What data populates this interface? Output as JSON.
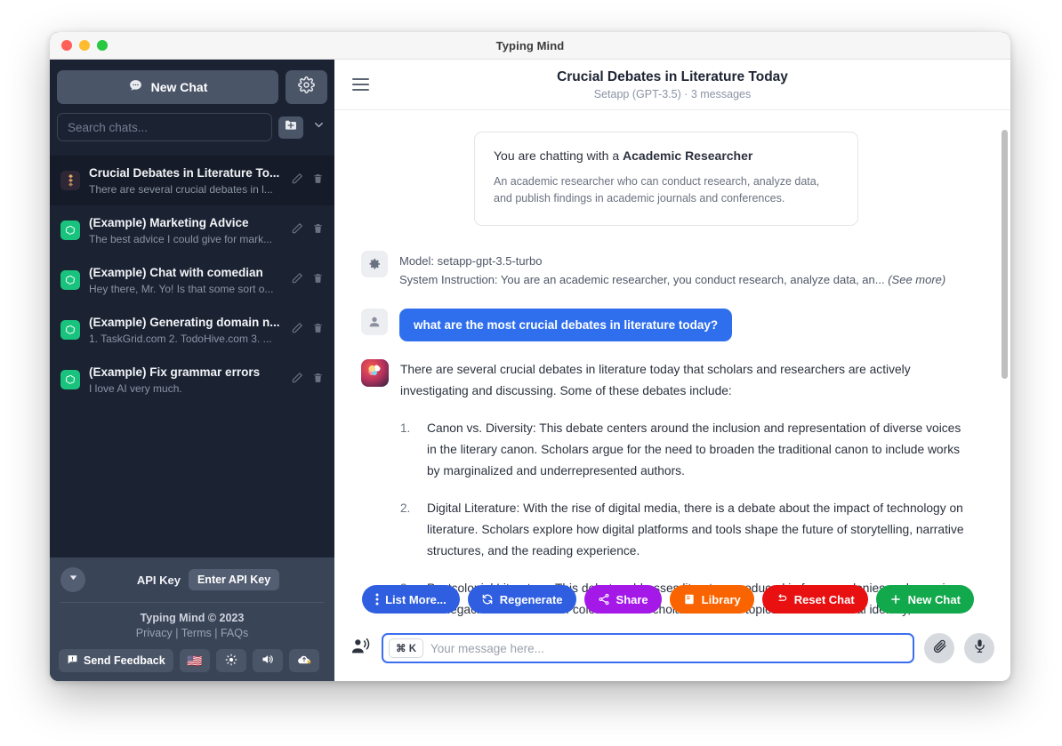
{
  "window": {
    "title": "Typing Mind",
    "traffic_lights": [
      "close-red",
      "minimize-yellow",
      "maximize-green"
    ]
  },
  "sidebar": {
    "new_chat_label": "New Chat",
    "settings_icon": "gear-icon",
    "search_placeholder": "Search chats...",
    "search_value": "",
    "new_folder_icon": "folder-plus-icon",
    "chevron_icon": "chevron-down-icon",
    "chats": [
      {
        "title": "Crucial Debates in Literature To...",
        "preview": "There are several crucial debates in l...",
        "avatar": "setapp-icon",
        "active": true
      },
      {
        "title": "(Example) Marketing Advice",
        "preview": "The best advice I could give for mark...",
        "avatar": "openai-icon",
        "active": false
      },
      {
        "title": "(Example) Chat with comedian",
        "preview": "Hey there, Mr. Yo! Is that some sort o...",
        "avatar": "openai-icon",
        "active": false
      },
      {
        "title": "(Example) Generating domain n...",
        "preview": "1. TaskGrid.com 2. TodoHive.com 3. ...",
        "avatar": "openai-icon",
        "active": false
      },
      {
        "title": "(Example) Fix grammar errors",
        "preview": "I love AI very much.",
        "avatar": "openai-icon",
        "active": false
      }
    ],
    "footer": {
      "collapse_icon": "chevron-down-circle-icon",
      "api_key_label": "API Key",
      "api_key_button": "Enter API Key",
      "copyright": "Typing Mind © 2023",
      "legal": {
        "privacy": "Privacy",
        "sep1": " | ",
        "terms": "Terms",
        "sep2": " | ",
        "faqs": "FAQs"
      },
      "send_feedback": "Send Feedback",
      "language_flag": "🇺🇸",
      "theme_icon": "sun-icon",
      "sound_icon": "speaker-icon",
      "backup_icon": "cloud-upload-icon"
    }
  },
  "header": {
    "menu_icon": "hamburger-icon",
    "title": "Crucial Debates in Literature Today",
    "subtitle": "Setapp (GPT-3.5)  ·  3 messages"
  },
  "persona_card": {
    "prefix": "You are chatting with a ",
    "role": "Academic Researcher",
    "description": "An academic researcher who can conduct research, analyze data, and publish findings in academic journals and conferences."
  },
  "system": {
    "avatar": "gear-icon",
    "model_line": "Model: setapp-gpt-3.5-turbo",
    "instruction_line": "System Instruction: You are an academic researcher, you conduct research, analyze data, an...",
    "see_more": "(See more)"
  },
  "messages": {
    "user": {
      "avatar": "user-icon",
      "text": "what are the most crucial debates in literature today?"
    },
    "assistant": {
      "avatar": "brain-tree-icon",
      "intro": "There are several crucial debates in literature today that scholars and researchers are actively investigating and discussing. Some of these debates include:",
      "items": [
        {
          "number": "1.",
          "text": "Canon vs. Diversity: This debate centers around the inclusion and representation of diverse voices in the literary canon. Scholars argue for the need to broaden the traditional canon to include works by marginalized and underrepresented authors."
        },
        {
          "number": "2.",
          "text": "Digital Literature: With the rise of digital media, there is a debate about the impact of technology on literature. Scholars explore how digital platforms and tools shape the future of storytelling, narrative structures, and the reading experience."
        },
        {
          "number": "3.",
          "text": "Postcolonial Literature: This debate addresses literature produced in former colonies and examines the legacies and effects of colonization. Scholars examine topics such as cultural identity,"
        }
      ]
    }
  },
  "action_buttons": [
    {
      "label": "List More...",
      "icon": "dots-vertical-icon",
      "color": "#2f5fe0"
    },
    {
      "label": "Regenerate",
      "icon": "refresh-icon",
      "color": "#2f5fe0"
    },
    {
      "label": "Share",
      "icon": "share-icon",
      "color": "#a418e8"
    },
    {
      "label": "Library",
      "icon": "book-icon",
      "color": "#fa6400"
    },
    {
      "label": "Reset Chat",
      "icon": "reset-icon",
      "color": "#e81010"
    },
    {
      "label": "New Chat",
      "icon": "plus-icon",
      "color": "#12a84c"
    }
  ],
  "composer": {
    "speak_icon": "speaking-person-icon",
    "shortcut": "⌘ K",
    "placeholder": "Your message here...",
    "value": "",
    "attach_icon": "paperclip-icon",
    "mic_icon": "microphone-icon"
  },
  "colors": {
    "sidebar_bg": "#1b2232",
    "sidebar_active": "#151b28",
    "sidebar_footer": "#3a4457",
    "user_bubble": "#2f6fed",
    "input_focus_border": "#3b6ef0",
    "openai_green": "#19c37d"
  }
}
